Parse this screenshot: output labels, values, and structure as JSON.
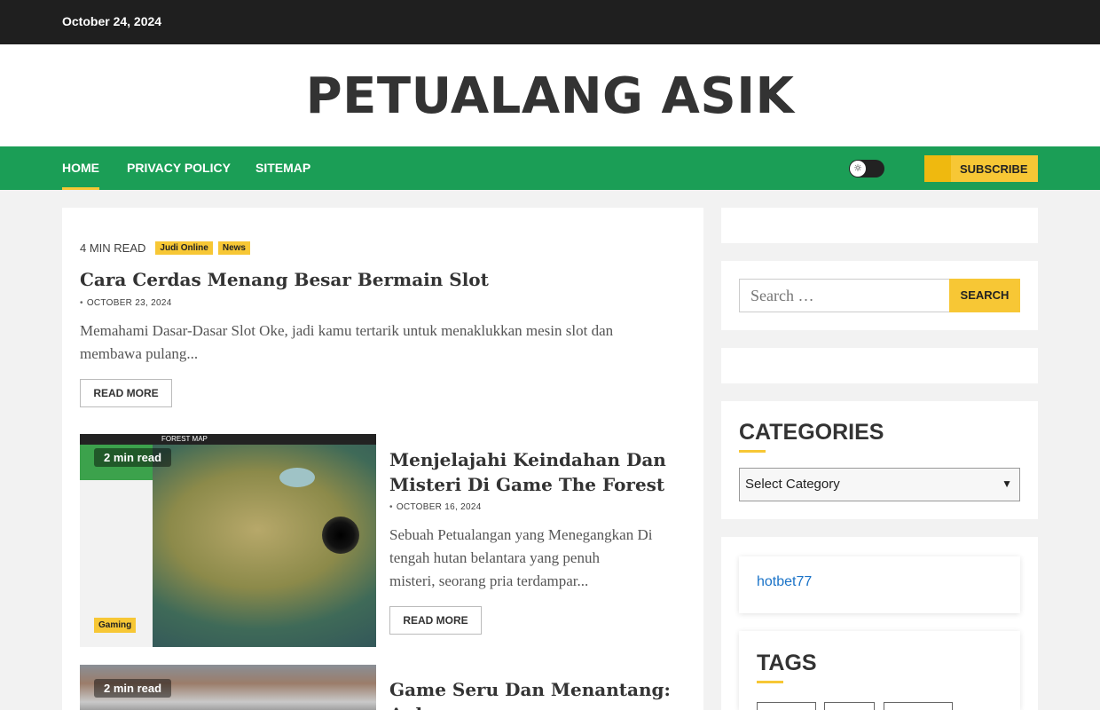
{
  "topbar": {
    "date": "October 24, 2024"
  },
  "header": {
    "site_title": "PETUALANG ASIK"
  },
  "nav": {
    "items": [
      "HOME",
      "PRIVACY POLICY",
      "SITEMAP"
    ],
    "subscribe_label": "SUBSCRIBE"
  },
  "posts": [
    {
      "read_time": "4 MIN READ",
      "categories": [
        "Judi Online",
        "News"
      ],
      "title": "Cara Cerdas Menang Besar Bermain Slot",
      "date": "OCTOBER 23, 2024",
      "excerpt_line1": "Memahami Dasar-Dasar Slot Oke, jadi kamu tertarik untuk menaklukkan mesin slot dan",
      "excerpt_line2": "membawa pulang...",
      "read_more": "READ MORE"
    },
    {
      "read_time": "2 min read",
      "category": "Gaming",
      "title_line1": "Menjelajahi Keindahan Dan",
      "title_line2": "Misteri Di Game The Forest",
      "date": "OCTOBER 16, 2024",
      "excerpt_line1": "Sebuah Petualangan yang Menegangkan Di",
      "excerpt_line2": "tengah hutan belantara yang penuh",
      "excerpt_line3": "misteri, seorang pria terdampar...",
      "read_more": "READ MORE",
      "thumb_header": "FOREST MAP"
    },
    {
      "read_time": "2 min read",
      "title_line1": "Game Seru Dan Menantang: Apk"
    }
  ],
  "sidebar": {
    "search_placeholder": "Search …",
    "search_button": "SEARCH",
    "categories_title": "CATEGORIES",
    "select_value": "Select Category",
    "link": "hotbet77",
    "tags_title": "TAGS"
  },
  "colors": {
    "accent_green": "#1b9e56",
    "accent_yellow": "#f7c735",
    "topbar": "#1f1f1f"
  }
}
